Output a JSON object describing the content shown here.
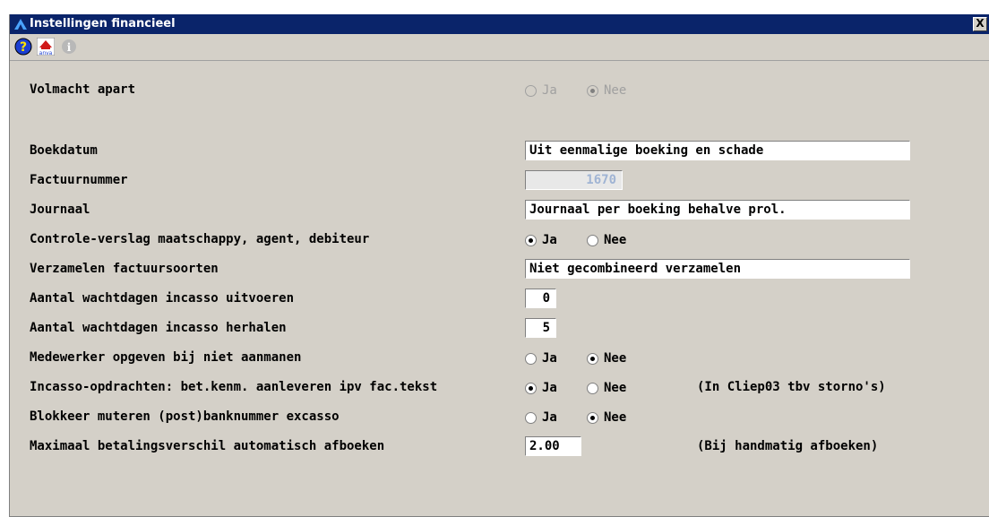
{
  "window": {
    "title": "Instellingen financieel",
    "close_label": "X"
  },
  "toolbar": {
    "help_label": "?",
    "anva_label": "anva",
    "info_label": "i"
  },
  "rows": [
    {
      "label": "Volmacht apart",
      "options": [
        "Ja",
        "Nee"
      ],
      "selected": "Nee",
      "disabled": true
    },
    {
      "label": "Boekdatum",
      "value": "Uit eenmalige boeking en schade"
    },
    {
      "label": "Factuurnummer",
      "value": "1670",
      "disabled": true
    },
    {
      "label": "Journaal",
      "value": "Journaal per boeking behalve prol."
    },
    {
      "label": "Controle-verslag maatschappy, agent, debiteur",
      "options": [
        "Ja",
        "Nee"
      ],
      "selected": "Ja"
    },
    {
      "label": "Verzamelen factuursoorten",
      "value": "Niet gecombineerd verzamelen"
    },
    {
      "label": "Aantal wachtdagen incasso uitvoeren",
      "value": "0"
    },
    {
      "label": "Aantal wachtdagen incasso herhalen",
      "value": "5"
    },
    {
      "label": "Medewerker opgeven bij niet aanmanen",
      "options": [
        "Ja",
        "Nee"
      ],
      "selected": "Nee"
    },
    {
      "label": "Incasso-opdrachten: bet.kenm. aanleveren ipv fac.tekst",
      "options": [
        "Ja",
        "Nee"
      ],
      "selected": "Ja",
      "note": "(In Cliep03 tbv storno's)"
    },
    {
      "label": "Blokkeer muteren (post)banknummer excasso",
      "options": [
        "Ja",
        "Nee"
      ],
      "selected": "Nee"
    },
    {
      "label": "Maximaal betalingsverschil automatisch afboeken",
      "value": "2.00",
      "note": "(Bij handmatig afboeken)"
    }
  ]
}
